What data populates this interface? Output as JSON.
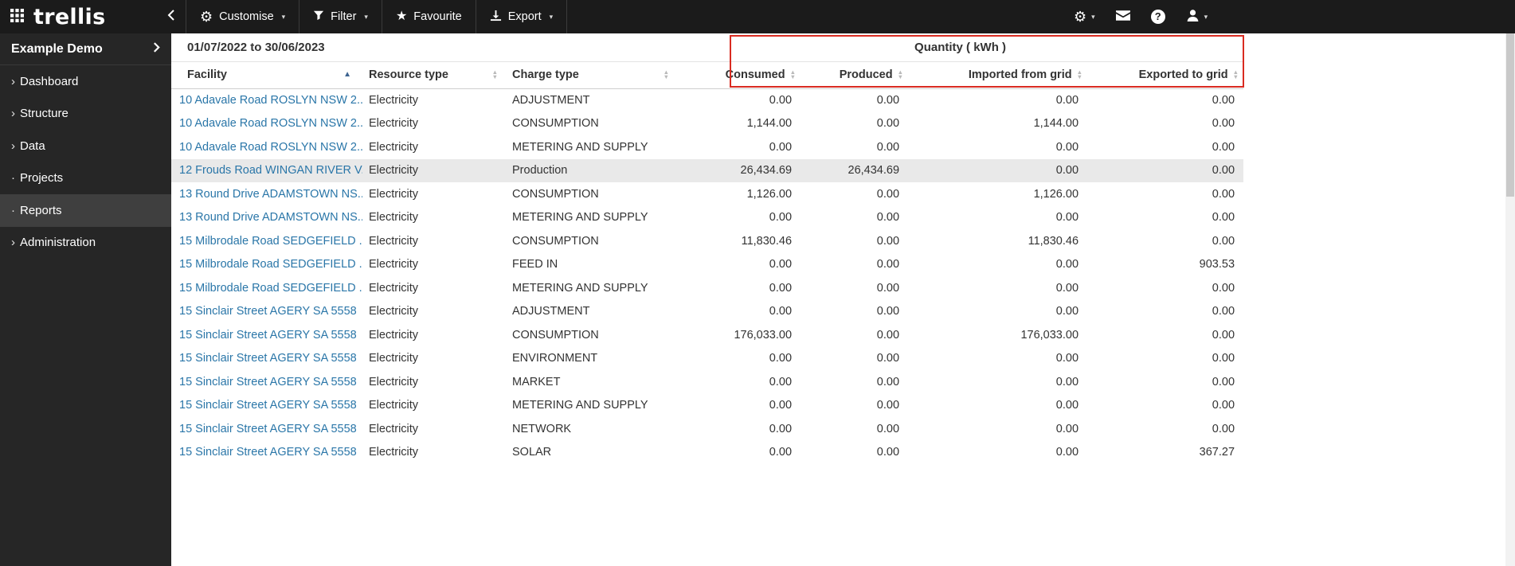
{
  "topbar": {
    "logo": "trellis",
    "buttons": {
      "customise": "Customise",
      "filter": "Filter",
      "favourite": "Favourite",
      "export": "Export"
    }
  },
  "sidebar": {
    "workspace": "Example Demo",
    "items": [
      {
        "label": "Dashboard",
        "prefix": "›",
        "active": false
      },
      {
        "label": "Structure",
        "prefix": "›",
        "active": false
      },
      {
        "label": "Data",
        "prefix": "›",
        "active": false
      },
      {
        "label": "Projects",
        "prefix": "·",
        "active": false
      },
      {
        "label": "Reports",
        "prefix": "·",
        "active": true
      },
      {
        "label": "Administration",
        "prefix": "›",
        "active": false
      }
    ]
  },
  "report": {
    "date_range": "01/07/2022 to 30/06/2023",
    "group_header": "Quantity ( kWh )",
    "columns": [
      "Facility",
      "Resource type",
      "Charge type",
      "Consumed",
      "Produced",
      "Imported from grid",
      "Exported to grid"
    ],
    "sort": {
      "column": "Facility",
      "direction": "asc"
    },
    "selected_row": 3,
    "rows": [
      [
        "10 Adavale Road ROSLYN NSW 2...",
        "Electricity",
        "ADJUSTMENT",
        "0.00",
        "0.00",
        "0.00",
        "0.00"
      ],
      [
        "10 Adavale Road ROSLYN NSW 2...",
        "Electricity",
        "CONSUMPTION",
        "1,144.00",
        "0.00",
        "1,144.00",
        "0.00"
      ],
      [
        "10 Adavale Road ROSLYN NSW 2...",
        "Electricity",
        "METERING AND SUPPLY",
        "0.00",
        "0.00",
        "0.00",
        "0.00"
      ],
      [
        "12 Frouds Road WINGAN RIVER V...",
        "Electricity",
        "Production",
        "26,434.69",
        "26,434.69",
        "0.00",
        "0.00"
      ],
      [
        "13 Round Drive ADAMSTOWN NS...",
        "Electricity",
        "CONSUMPTION",
        "1,126.00",
        "0.00",
        "1,126.00",
        "0.00"
      ],
      [
        "13 Round Drive ADAMSTOWN NS...",
        "Electricity",
        "METERING AND SUPPLY",
        "0.00",
        "0.00",
        "0.00",
        "0.00"
      ],
      [
        "15 Milbrodale Road SEDGEFIELD ...",
        "Electricity",
        "CONSUMPTION",
        "11,830.46",
        "0.00",
        "11,830.46",
        "0.00"
      ],
      [
        "15 Milbrodale Road SEDGEFIELD ...",
        "Electricity",
        "FEED IN",
        "0.00",
        "0.00",
        "0.00",
        "903.53"
      ],
      [
        "15 Milbrodale Road SEDGEFIELD ...",
        "Electricity",
        "METERING AND SUPPLY",
        "0.00",
        "0.00",
        "0.00",
        "0.00"
      ],
      [
        "15 Sinclair Street AGERY SA 5558",
        "Electricity",
        "ADJUSTMENT",
        "0.00",
        "0.00",
        "0.00",
        "0.00"
      ],
      [
        "15 Sinclair Street AGERY SA 5558",
        "Electricity",
        "CONSUMPTION",
        "176,033.00",
        "0.00",
        "176,033.00",
        "0.00"
      ],
      [
        "15 Sinclair Street AGERY SA 5558",
        "Electricity",
        "ENVIRONMENT",
        "0.00",
        "0.00",
        "0.00",
        "0.00"
      ],
      [
        "15 Sinclair Street AGERY SA 5558",
        "Electricity",
        "MARKET",
        "0.00",
        "0.00",
        "0.00",
        "0.00"
      ],
      [
        "15 Sinclair Street AGERY SA 5558",
        "Electricity",
        "METERING AND SUPPLY",
        "0.00",
        "0.00",
        "0.00",
        "0.00"
      ],
      [
        "15 Sinclair Street AGERY SA 5558",
        "Electricity",
        "NETWORK",
        "0.00",
        "0.00",
        "0.00",
        "0.00"
      ],
      [
        "15 Sinclair Street AGERY SA 5558",
        "Electricity",
        "SOLAR",
        "0.00",
        "0.00",
        "0.00",
        "367.27"
      ]
    ]
  },
  "colors": {
    "topbar_bg": "#1b1b1b",
    "sidebar_bg": "#262626",
    "sidebar_active_bg": "#3f3f3f",
    "link": "#2a76a8",
    "row_highlight": "#e9e9e9",
    "annotation": "#d92b21",
    "sort_active": "#3c6390"
  }
}
